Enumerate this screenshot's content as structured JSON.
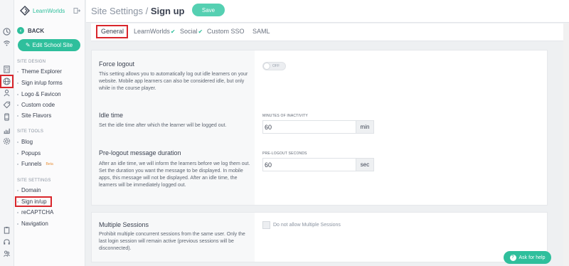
{
  "brand": {
    "name": "LearnWorlds",
    "accent": "#2fbf9c",
    "highlight": "#d9262c"
  },
  "rail": {
    "icons": [
      "dashboard-icon",
      "wifi-icon",
      "calculator-icon",
      "globe-icon",
      "user-icon",
      "tag-icon",
      "mobile-icon",
      "chart-icon",
      "settings-icon",
      "clipboard-icon",
      "headset-icon",
      "users-icon"
    ]
  },
  "sidebar": {
    "back_label": "BACK",
    "edit_label": "Edit School Site",
    "site_design_title": "SITE DESIGN",
    "site_design": [
      "Theme Explorer",
      "Sign in/up forms",
      "Logo & Favicon",
      "Custom code",
      "Site Flavors"
    ],
    "site_tools_title": "SITE TOOLS",
    "site_tools": [
      "Blog",
      "Popups",
      "Funnels"
    ],
    "funnels_badge": "Beta",
    "site_settings_title": "SITE SETTINGS",
    "site_settings": [
      "Domain",
      "Sign in/up",
      "reCAPTCHA",
      "Navigation"
    ]
  },
  "header": {
    "title_prefix": "Site Settings / ",
    "title_main": "Sign up",
    "save_label": "Save"
  },
  "tabs": [
    "General",
    "LearnWorlds",
    "Social",
    "Custom SSO",
    "SAML"
  ],
  "sections": {
    "force_logout": {
      "title": "Force logout",
      "desc": "This setting allows you to automatically log out idle learners on your website. Mobile app learners can also be considered idle, but only while in the course player.",
      "toggle_label": "OFF"
    },
    "idle_time": {
      "title": "Idle time",
      "desc": "Set the idle time after which the learner will be logged out.",
      "field_label": "MINUTES OF INACTIVITY",
      "value": "60",
      "unit": "min"
    },
    "pre_logout": {
      "title": "Pre-logout message duration",
      "desc": "After an idle time, we will inform the learners before we log them out. Set the duration you want the message to be displayed. In mobile apps, this message will not be displayed. After an idle time, the learners will be immediately logged out.",
      "field_label": "PRE-LOGOUT SECONDS",
      "value": "60",
      "unit": "sec"
    },
    "multiple_sessions": {
      "title": "Multiple Sessions",
      "desc": "Prohibit multiple concurrent sessions from the same user. Only the last login session will remain active (previous sessions will be disconnected).",
      "checkbox_label": "Do not allow Multiple Sessions"
    }
  },
  "help_label": "Ask for help"
}
